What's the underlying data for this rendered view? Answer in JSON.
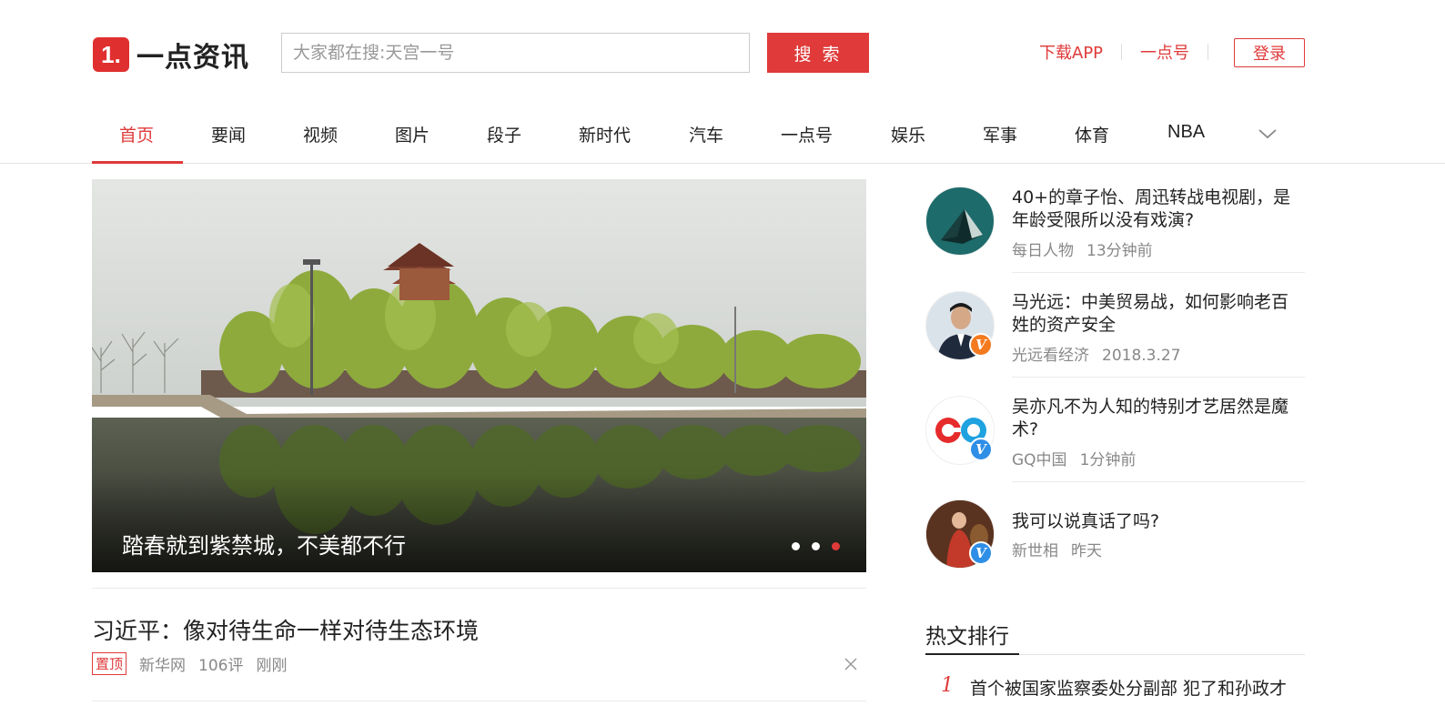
{
  "header": {
    "logo_mark": "1.",
    "logo_text": "一点资讯",
    "search_placeholder": "大家都在搜:天宫一号",
    "search_button": "搜 索",
    "links": [
      "下载APP",
      "一点号"
    ],
    "login": "登录"
  },
  "nav": {
    "items": [
      "首页",
      "要闻",
      "视频",
      "图片",
      "段子",
      "新时代",
      "汽车",
      "一点号",
      "娱乐",
      "军事",
      "体育",
      "NBA"
    ],
    "active_index": 0
  },
  "carousel": {
    "caption": "踏春就到紫禁城，不美都不行",
    "slide_count": 3,
    "active_slide": 3
  },
  "headline": {
    "title": "习近平：像对待生命一样对待生态环境",
    "badge": "置顶",
    "source": "新华网",
    "comments": "106评",
    "time": "刚刚"
  },
  "feed": [
    {
      "title": "40+的章子怡、周迅转战电视剧，是年龄受限所以没有戏演?",
      "source": "每日人物",
      "time": "13分钟前",
      "verified": false
    },
    {
      "title": "马光远：中美贸易战，如何影响老百姓的资产安全",
      "source": "光远看经济",
      "time": "2018.3.27",
      "verified": true,
      "badge_color": "#f47a20"
    },
    {
      "title": "吴亦凡不为人知的特别才艺居然是魔术?",
      "source": "GQ中国",
      "time": "1分钟前",
      "verified": true,
      "badge_color": "#2f8fe6"
    },
    {
      "title": "我可以说真话了吗?",
      "source": "新世相",
      "time": "昨天",
      "verified": true,
      "badge_color": "#2f8fe6"
    }
  ],
  "hot": {
    "title": "热文排行",
    "items": [
      {
        "rank": "1",
        "title": "首个被国家监察委处分副部 犯了和孙政才"
      }
    ]
  },
  "colors": {
    "accent": "#e03a3a"
  }
}
